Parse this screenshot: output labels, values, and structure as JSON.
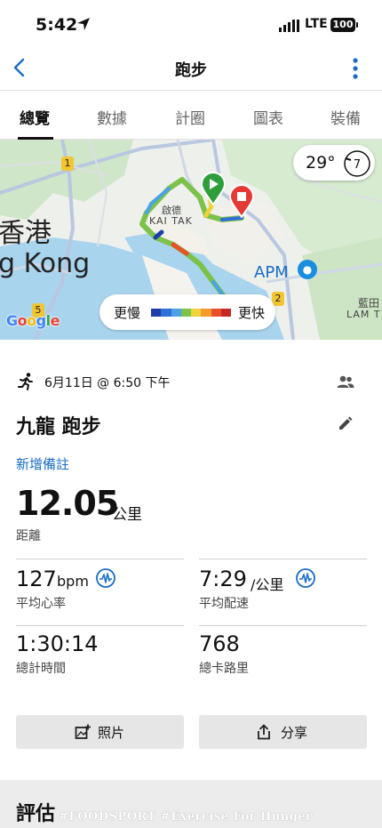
{
  "status_bar": {
    "time": "5:42",
    "network": "LTE",
    "battery": "100"
  },
  "nav": {
    "title": "跑步"
  },
  "tabs": [
    {
      "label": "總覽",
      "active": true
    },
    {
      "label": "數據"
    },
    {
      "label": "計圈"
    },
    {
      "label": "圖表"
    },
    {
      "label": "裝備"
    }
  ],
  "map": {
    "labels": {
      "hong_kong_zh": "香港",
      "hong_kong_en": "g Kong",
      "kai_tak_zh": "啟德",
      "kai_tak_en": "KAI TAK",
      "apm": "APM",
      "lam_tin_zh": "藍田",
      "lam_tin_en": "LAM T",
      "road_1": "1",
      "road_2": "2",
      "road_5": "5"
    },
    "weather": {
      "temperature": "29°",
      "wind_speed": "7"
    },
    "pace_legend": {
      "slower": "更慢",
      "faster": "更快",
      "colors": [
        "#1f3fa8",
        "#2f6fd8",
        "#49a3e6",
        "#7cc24a",
        "#f0d23c",
        "#f39a2c",
        "#e8502a",
        "#c62828"
      ]
    },
    "attribution": "Google"
  },
  "activity": {
    "datetime": "6月11日 @ 6:50 下午",
    "title": "九龍 跑步",
    "add_note": "新增備註",
    "distance": {
      "value": "12.05",
      "unit": "公里",
      "label": "距離"
    },
    "avg_hr": {
      "value": "127",
      "unit": "bpm",
      "label": "平均心率"
    },
    "avg_pace": {
      "value": "7:29",
      "unit": "/公里",
      "label": "平均配速"
    },
    "total_time": {
      "value": "1:30:14",
      "label": "總計時間"
    },
    "calories": {
      "value": "768",
      "label": "總卡路里"
    }
  },
  "buttons": {
    "photos": "照片",
    "share": "分享"
  },
  "evaluation": {
    "title": "評估"
  },
  "watermark": "#FOODSPORT #Exercise For Hunger",
  "colors": {
    "link": "#1a6dc4",
    "accent": "#1a6dc4",
    "start": "#2e9e3a",
    "stop": "#e53935"
  }
}
